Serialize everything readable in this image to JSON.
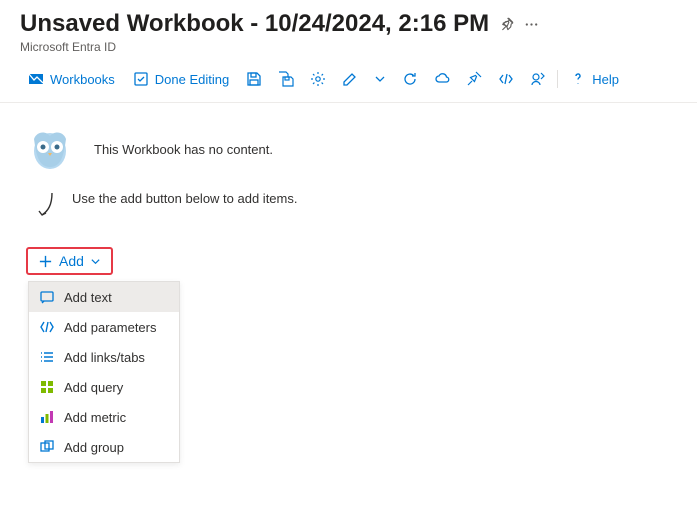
{
  "header": {
    "title": "Unsaved Workbook - 10/24/2024, 2:16 PM",
    "subtitle": "Microsoft Entra ID"
  },
  "toolbar": {
    "workbooks": "Workbooks",
    "done_editing": "Done Editing",
    "help": "Help"
  },
  "content": {
    "empty_message": "This Workbook has no content.",
    "hint": "Use the add button below to add items.",
    "add_label": "Add"
  },
  "menu": {
    "items": [
      {
        "label": "Add text"
      },
      {
        "label": "Add parameters"
      },
      {
        "label": "Add links/tabs"
      },
      {
        "label": "Add query"
      },
      {
        "label": "Add metric"
      },
      {
        "label": "Add group"
      }
    ]
  }
}
